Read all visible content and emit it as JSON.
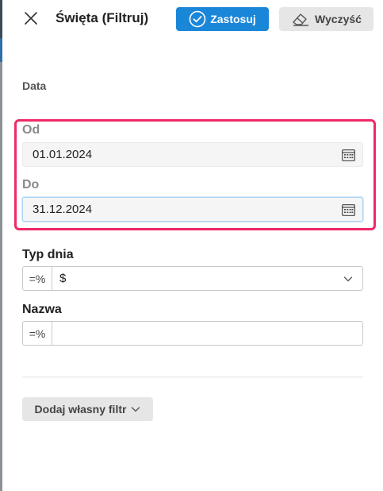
{
  "header": {
    "title": "Święta (Filtruj)",
    "apply_label": "Zastosuj",
    "clear_label": "Wyczyść"
  },
  "section": {
    "label": "Data"
  },
  "date_from": {
    "label": "Od",
    "value": "01.01.2024"
  },
  "date_to": {
    "label": "Do",
    "value": "31.12.2024"
  },
  "day_type": {
    "label": "Typ dnia",
    "operator": "=%",
    "value": "$"
  },
  "name": {
    "label": "Nazwa",
    "operator": "=%",
    "value": ""
  },
  "add_filter": {
    "label": "Dodaj własny filtr"
  },
  "icons": {
    "close": "close-icon",
    "apply": "check-circle-icon",
    "clear": "eraser-icon",
    "calendar": "calendar-icon",
    "chevron": "chevron-down-icon"
  },
  "colors": {
    "primary": "#1a86d8",
    "highlight": "#ee2a67",
    "secondary_button": "#e6e6e6"
  }
}
